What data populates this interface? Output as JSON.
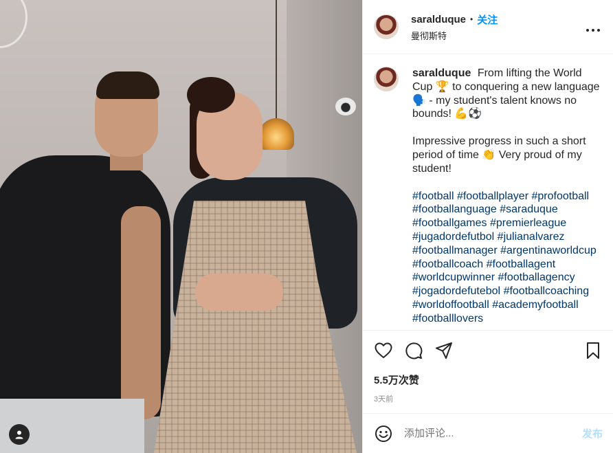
{
  "post": {
    "username": "saralduque",
    "dot": "•",
    "follow_label": "关注",
    "location": "曼彻斯特",
    "more_icon": "more-icon"
  },
  "caption": {
    "username": "saralduque",
    "text1": "From lifting the World Cup 🏆 to conquering a new language 🗣️ - my student's talent knows no bounds! 💪⚽",
    "text2": "Impressive progress in such a short period of time 👏 Very proud of my student!",
    "hashtags": [
      "#football",
      "#footballplayer",
      "#profootball",
      "#footballanguage",
      "#saraduque",
      "#footballgames",
      "#premierleague",
      "#jugadordefutbol",
      "#julianalvarez",
      "#footballmanager",
      "#argentinaworldcup",
      "#footballcoach",
      "#footballagent",
      "#worldcupwinner",
      "#footballagency",
      "#jogadordefutebol",
      "#footballcoaching",
      "#worldoffootball",
      "#academyfootball",
      "#footballlovers"
    ]
  },
  "actions": {
    "icons": [
      "heart-icon",
      "comment-icon",
      "share-icon",
      "bookmark-icon"
    ],
    "likes": "5.5万次赞",
    "time": "3天前"
  },
  "comment": {
    "placeholder": "添加评论...",
    "post_label": "发布",
    "emoji_icon": "emoji-icon"
  },
  "colors": {
    "accent": "#0095f6",
    "hashtag": "#00376b",
    "muted": "#8e8e8e",
    "post_disabled": "#b2dffc"
  }
}
